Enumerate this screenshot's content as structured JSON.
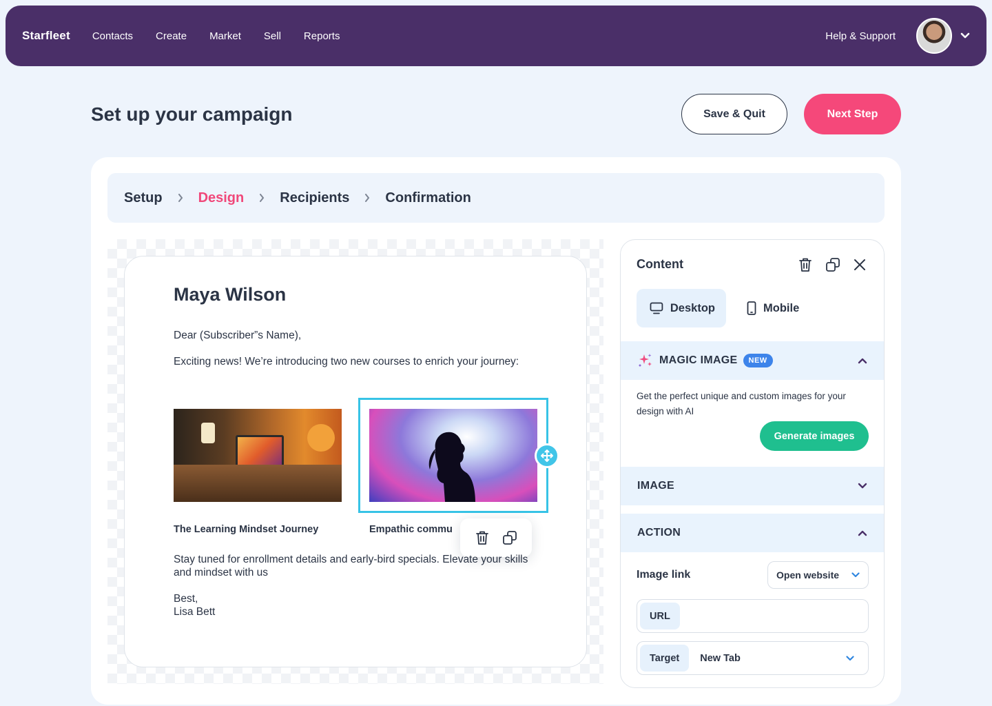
{
  "nav": {
    "brand": "Starfleet",
    "links": [
      "Contacts",
      "Create",
      "Market",
      "Sell",
      "Reports"
    ],
    "help": "Help & Support"
  },
  "header": {
    "title": "Set up your campaign",
    "save_label": "Save & Quit",
    "next_label": "Next Step"
  },
  "steps": [
    {
      "label": "Setup",
      "active": false
    },
    {
      "label": "Design",
      "active": true
    },
    {
      "label": "Recipients",
      "active": false
    },
    {
      "label": "Confirmation",
      "active": false
    }
  ],
  "email": {
    "name": "Maya Wilson",
    "greeting": "Dear (Subscriber”s Name),",
    "intro": "Exciting news! We’re introducing two new courses to enrich your journey:",
    "caption1": "The Learning Mindset Journey",
    "caption2": "Empathic commu",
    "outro": "Stay tuned for enrollment details and early-bird specials. Elevate your skills and mindset with us",
    "signoff": "Best,",
    "signature": "Lisa Bett"
  },
  "panel": {
    "title": "Content",
    "desktop_label": "Desktop",
    "mobile_label": "Mobile",
    "magic_label": "MAGIC IMAGE",
    "magic_badge": "NEW",
    "magic_desc": "Get the perfect unique and custom images for your design with AI",
    "generate_label": "Generate images",
    "image_label": "IMAGE",
    "action_label": "ACTION",
    "image_link_label": "Image link",
    "image_link_value": "Open website",
    "url_tag": "URL",
    "target_tag": "Target",
    "target_value": "New Tab"
  },
  "colors": {
    "nav_bg": "#4a2f68",
    "accent_pink": "#f5487a",
    "accent_green": "#1fbf8f",
    "selection": "#37c3e6",
    "badge_blue": "#3d84ea"
  }
}
